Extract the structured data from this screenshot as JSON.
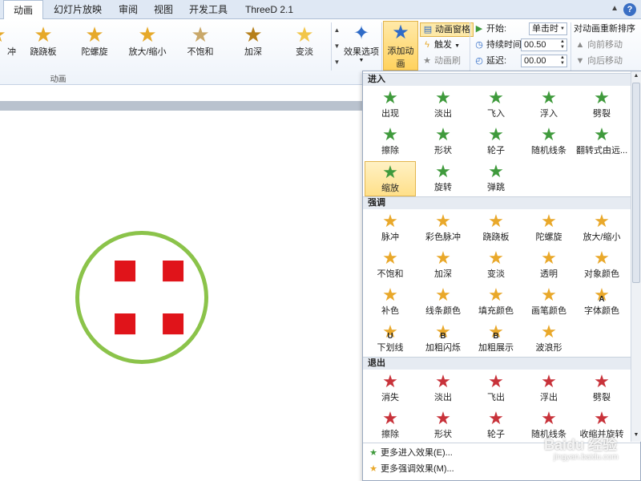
{
  "tabs": [
    "动画",
    "幻灯片放映",
    "审阅",
    "视图",
    "开发工具",
    "ThreeD 2.1"
  ],
  "ribbon": {
    "gallery": [
      {
        "label": "冲",
        "icon": "star-pulse-icon"
      },
      {
        "label": "跷跷板",
        "icon": "star-teeter-icon"
      },
      {
        "label": "陀螺旋",
        "icon": "star-spin-icon"
      },
      {
        "label": "放大/缩小",
        "icon": "star-grow-icon"
      },
      {
        "label": "不饱和",
        "icon": "star-desaturate-icon"
      },
      {
        "label": "加深",
        "icon": "star-darken-icon"
      },
      {
        "label": "变淡",
        "icon": "star-lighten-icon"
      }
    ],
    "effect_options": "效果选项",
    "group_label": "动画",
    "add_animation": "添加动画",
    "animation_pane": "动画窗格",
    "trigger": "触发",
    "animation_painter": "动画刷",
    "start_label": "开始:",
    "start_value": "单击时",
    "duration_label": "持续时间:",
    "duration_value": "00.50",
    "delay_label": "延迟:",
    "delay_value": "00.00",
    "reorder_title": "对动画重新排序",
    "move_earlier": "向前移动",
    "move_later": "向后移动"
  },
  "dropdown": {
    "entrance_title": "进入",
    "entrance": [
      "出现",
      "淡出",
      "飞入",
      "浮入",
      "劈裂",
      "擦除",
      "形状",
      "轮子",
      "随机线条",
      "翻转式由远...",
      "缩放",
      "旋转",
      "弹跳"
    ],
    "entrance_selected": "缩放",
    "emphasis_title": "强调",
    "emphasis": [
      "脉冲",
      "彩色脉冲",
      "跷跷板",
      "陀螺旋",
      "放大/缩小",
      "不饱和",
      "加深",
      "变淡",
      "透明",
      "对象颜色",
      "补色",
      "线条颜色",
      "填充颜色",
      "画笔颜色",
      "字体颜色",
      "下划线",
      "加粗闪烁",
      "加粗展示",
      "波浪形"
    ],
    "emphasis_badges": [
      "",
      "",
      "",
      "",
      "",
      "",
      "",
      "",
      "",
      "",
      "",
      "",
      "",
      "",
      "A",
      "U",
      "B",
      "B",
      ""
    ],
    "exit_title": "退出",
    "exit": [
      "消失",
      "淡出",
      "飞出",
      "浮出",
      "劈裂",
      "擦除",
      "形状",
      "轮子",
      "随机线条",
      "收缩并旋转"
    ],
    "more_entrance": "更多进入效果(E)...",
    "more_emphasis": "更多强调效果(M)..."
  },
  "watermark": "Baidu 经验",
  "watermark_url": "jingyan.baidu.com",
  "colors": {
    "accent_tab": "#dfe8f4",
    "selected_fill": "#ffe08a",
    "stamp_ring": "#8bc34a",
    "stamp_ink": "#e0141a",
    "entrance": "#3f9a3c",
    "emphasis": "#e9a82a",
    "exit": "#c8323a"
  }
}
